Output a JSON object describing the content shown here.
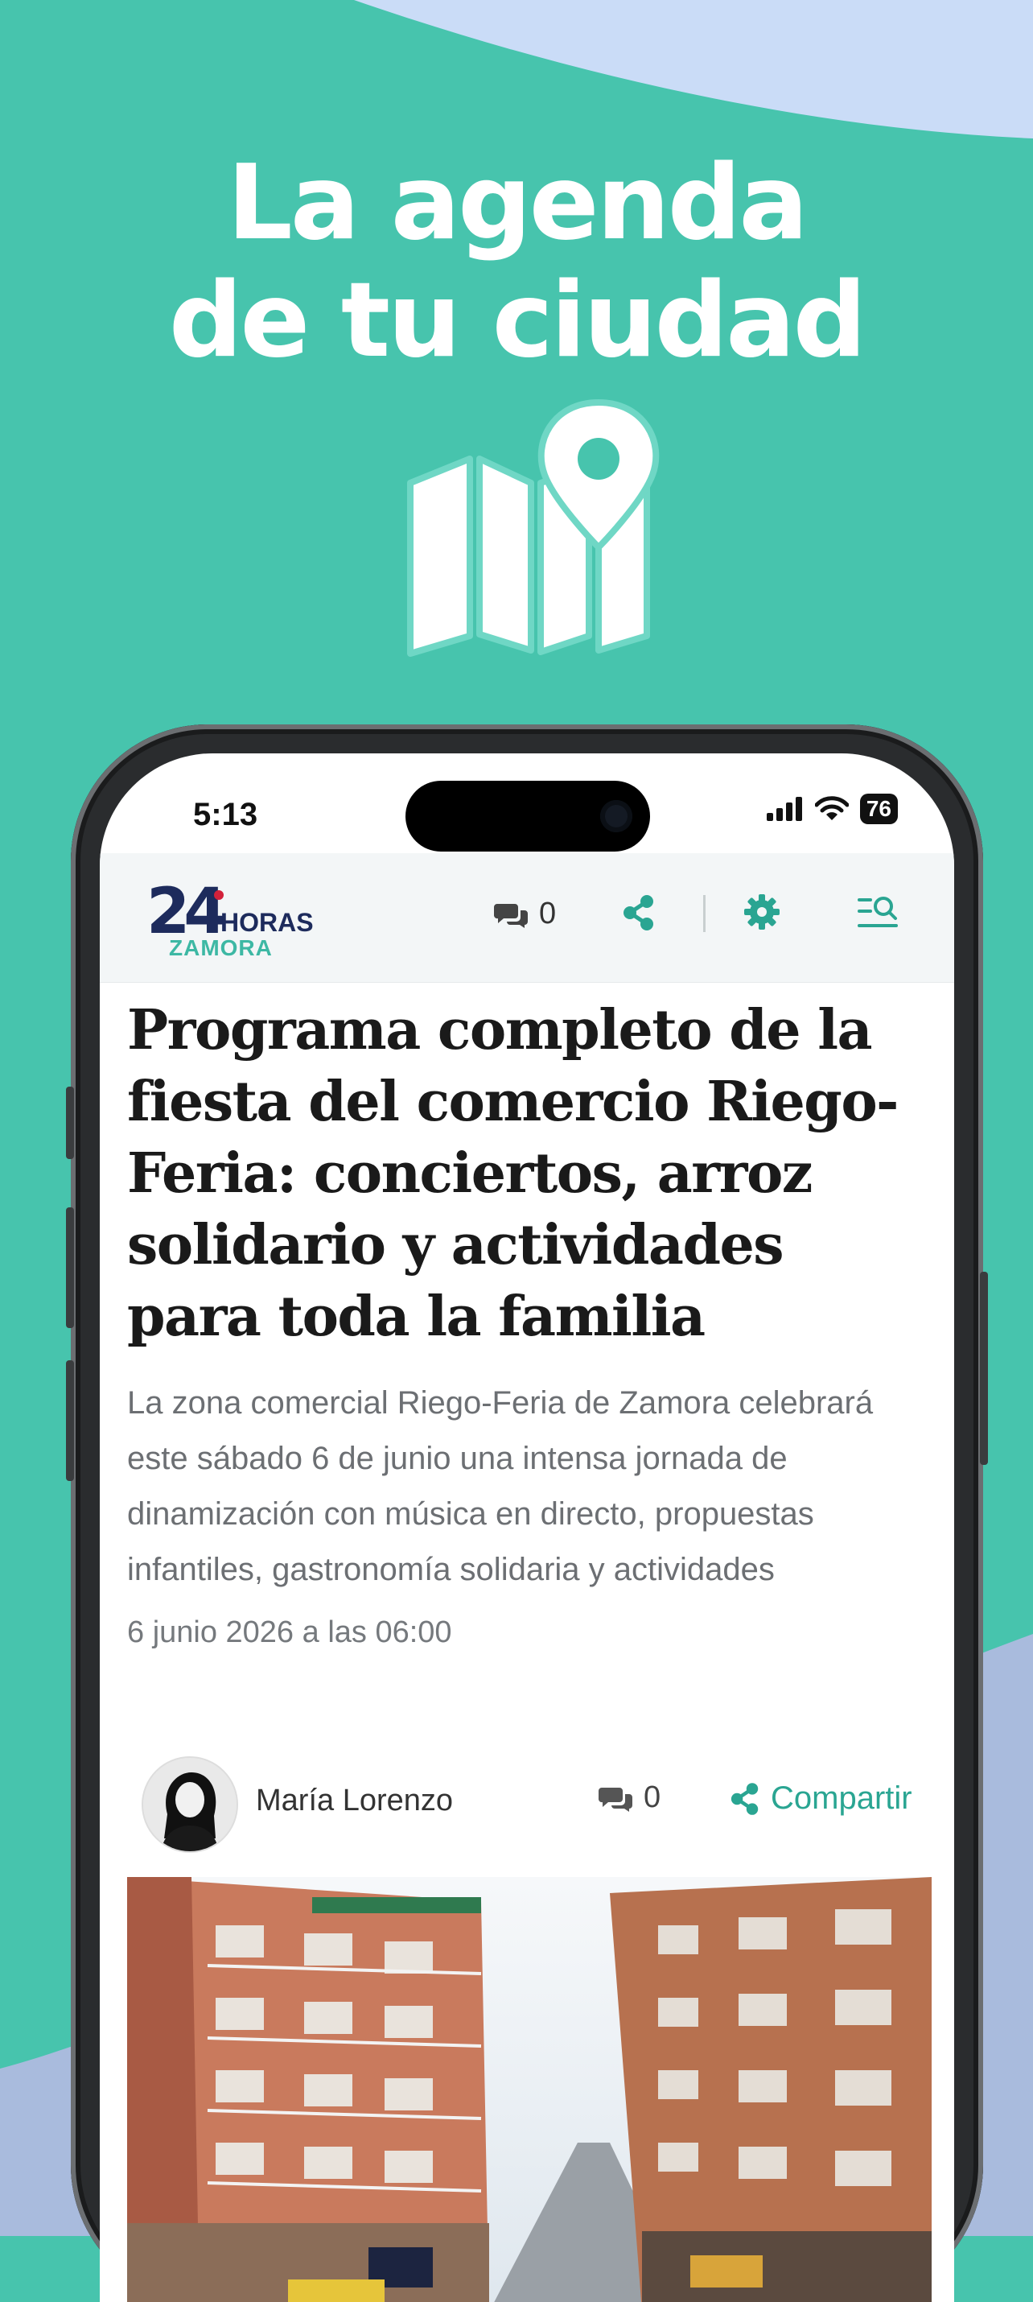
{
  "headline": {
    "line1": "La agenda",
    "line2": "de tu ciudad"
  },
  "colors": {
    "background": "#47C4AD",
    "wave": "#CADCF7",
    "accent": "#2AA592",
    "logo_navy": "#1D2B5C"
  },
  "status_bar": {
    "time": "5:13",
    "battery": "76"
  },
  "app_header": {
    "logo": {
      "number": "24",
      "word": "HORAS",
      "city": "ZAMORA"
    },
    "comment_count": "0",
    "icons": [
      "comments-icon",
      "share-icon",
      "gear-icon",
      "search-menu-icon"
    ]
  },
  "article": {
    "title": "Programa completo de la fiesta del comercio Riego-Feria: conciertos, arroz solidario y actividades para toda la familia",
    "summary": "La zona comercial Riego-Feria de Zamora celebrará este sábado 6 de junio una intensa jornada de dinamización con música en directo, propuestas infantiles, gastronomía solidaria y actividades",
    "date": "6 junio 2026 a las 06:00",
    "author": "María Lorenzo",
    "comment_count": "0",
    "share_label": "Compartir"
  }
}
